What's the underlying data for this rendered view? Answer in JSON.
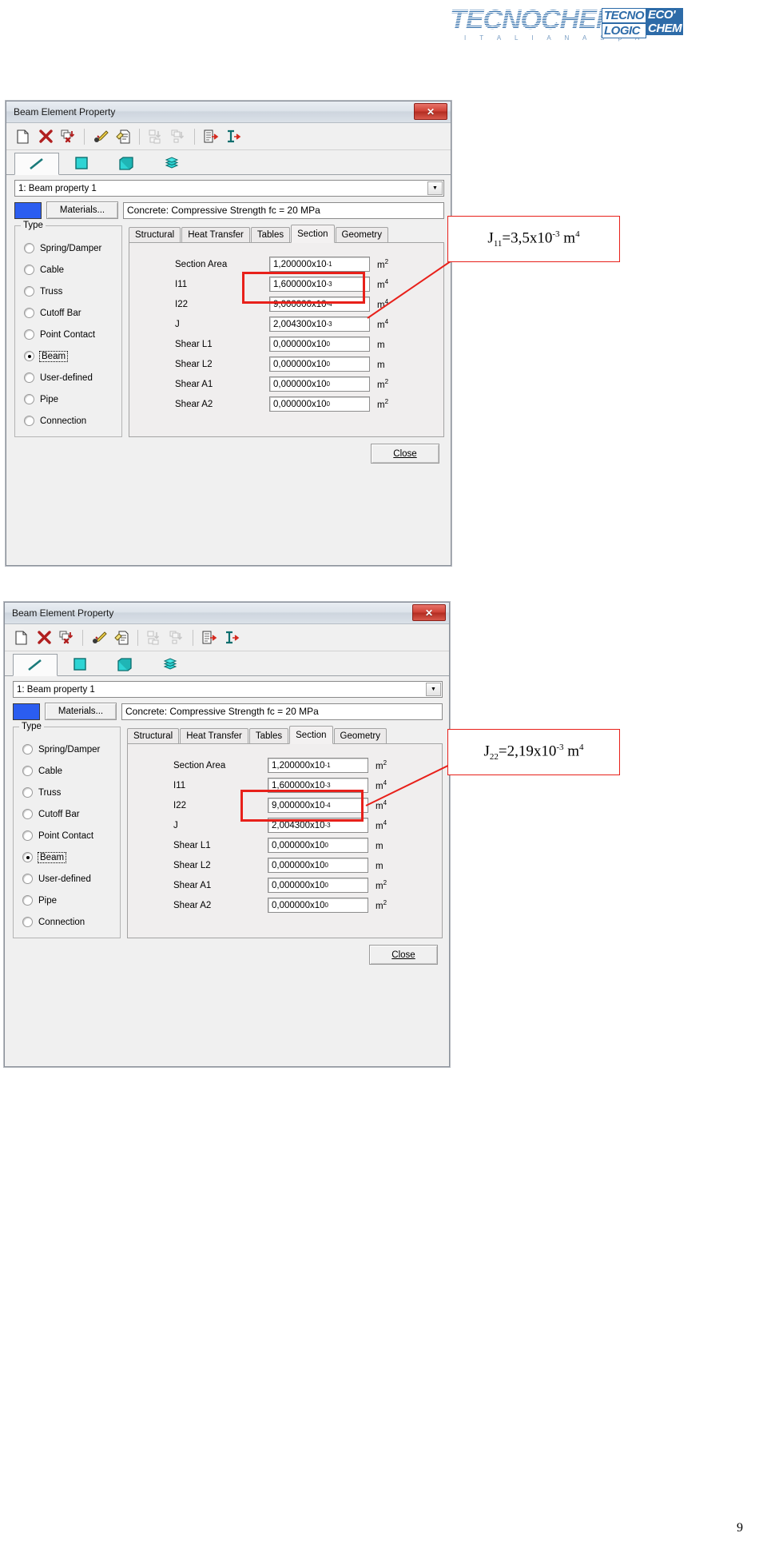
{
  "logo": {
    "brand": "TECNOCHEM",
    "registered": "®",
    "subtitle": "I T A L I A N A   S p A",
    "boxes": [
      {
        "line1": "TECNO",
        "line2": "LOGIC",
        "style": "white"
      },
      {
        "line1": "ECO'",
        "line2": "CHEM",
        "style": "blue"
      }
    ]
  },
  "dialog": {
    "title": "Beam Element Property",
    "close_glyph": "✕",
    "toolbar_icons": [
      "new-document-icon",
      "delete-icon",
      "delete-multiple-icon",
      "edit-paint-icon",
      "edit-properties-icon",
      "copy-single-icon",
      "copy-multiple-icon",
      "export-table-icon",
      "import-section-icon"
    ],
    "element_type_tabs": [
      {
        "icon": "line-element-icon",
        "selected": true
      },
      {
        "icon": "plane-element-icon",
        "selected": false
      },
      {
        "icon": "solid-element-icon",
        "selected": false
      },
      {
        "icon": "layered-element-icon",
        "selected": false
      }
    ],
    "property_selector": {
      "value": "1: Beam property 1",
      "arrow": "▼"
    },
    "material": {
      "color": "#2b5df0",
      "button_label": "Materials...",
      "value": "Concrete: Compressive Strength fc = 20 MPa"
    },
    "type_group": {
      "legend": "Type",
      "options": [
        {
          "label": "Spring/Damper",
          "selected": false
        },
        {
          "label": "Cable",
          "selected": false
        },
        {
          "label": "Truss",
          "selected": false
        },
        {
          "label": "Cutoff Bar",
          "selected": false
        },
        {
          "label": "Point Contact",
          "selected": false
        },
        {
          "label": "Beam",
          "selected": true
        },
        {
          "label": "User-defined",
          "selected": false
        },
        {
          "label": "Pipe",
          "selected": false
        },
        {
          "label": "Connection",
          "selected": false
        }
      ]
    },
    "tabs": [
      {
        "label": "Structural",
        "active": false
      },
      {
        "label": "Heat Transfer",
        "active": false
      },
      {
        "label": "Tables",
        "active": false
      },
      {
        "label": "Section",
        "active": true
      },
      {
        "label": "Geometry",
        "active": false
      }
    ],
    "section_fields": [
      {
        "label": "Section Area",
        "mantissa": "1,200000x10",
        "exp": "-1",
        "unit": "m",
        "unit_exp": "2"
      },
      {
        "label": "I11",
        "mantissa": "1,600000x10",
        "exp": "-3",
        "unit": "m",
        "unit_exp": "4"
      },
      {
        "label": "I22",
        "mantissa": "9,000000x10",
        "exp": "-4",
        "unit": "m",
        "unit_exp": "4"
      },
      {
        "label": "J",
        "mantissa": "2,004300x10",
        "exp": "-3",
        "unit": "m",
        "unit_exp": "4"
      },
      {
        "label": "Shear L1",
        "mantissa": "0,000000x10",
        "exp": "0",
        "unit": "m",
        "unit_exp": ""
      },
      {
        "label": "Shear L2",
        "mantissa": "0,000000x10",
        "exp": "0",
        "unit": "m",
        "unit_exp": ""
      },
      {
        "label": "Shear A1",
        "mantissa": "0,000000x10",
        "exp": "0",
        "unit": "m",
        "unit_exp": "2"
      },
      {
        "label": "Shear A2",
        "mantissa": "0,000000x10",
        "exp": "0",
        "unit": "m",
        "unit_exp": "2"
      }
    ],
    "close_button": "Close"
  },
  "annotations": {
    "highlight_color": "#e8201a",
    "callout_1": {
      "symbol": "J",
      "sub": "11",
      "eq": "=3,5x10",
      "sup": "-3",
      "unit": " m",
      "unit_sup": "4"
    },
    "callout_2": {
      "symbol": "J",
      "sub": "22",
      "eq": "=2,19x10",
      "sup": "-3",
      "unit": " m",
      "unit_sup": "4"
    }
  },
  "page_number": "9"
}
